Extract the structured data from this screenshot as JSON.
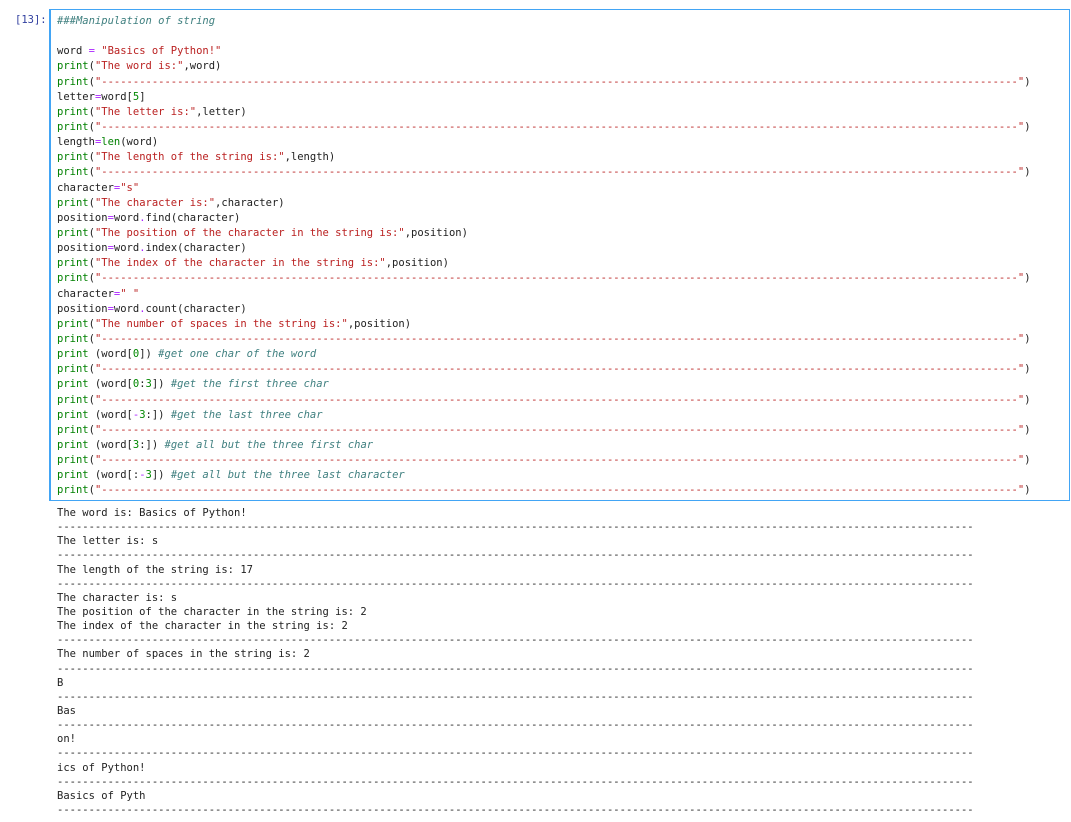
{
  "cell": {
    "prompt": "[13]:",
    "code_lines": [
      [
        {
          "t": "###Manipulation of string",
          "c": "cm"
        }
      ],
      [
        {
          "t": "",
          "c": "pl"
        }
      ],
      [
        {
          "t": "word ",
          "c": "pl"
        },
        {
          "t": "=",
          "c": "op"
        },
        {
          "t": " ",
          "c": "pl"
        },
        {
          "t": "\"Basics of Python!\"",
          "c": "st"
        }
      ],
      [
        {
          "t": "print",
          "c": "kw"
        },
        {
          "t": "(",
          "c": "pl"
        },
        {
          "t": "\"The word is:\"",
          "c": "st"
        },
        {
          "t": ",word)",
          "c": "pl"
        }
      ],
      [
        {
          "t": "print",
          "c": "kw"
        },
        {
          "t": "(",
          "c": "pl"
        },
        {
          "t": "\"-------------------------------------------------------------------------------------------------------------------------------------------------\"",
          "c": "st"
        },
        {
          "t": ")",
          "c": "pl"
        }
      ],
      [
        {
          "t": "letter",
          "c": "pl"
        },
        {
          "t": "=",
          "c": "op"
        },
        {
          "t": "word[",
          "c": "pl"
        },
        {
          "t": "5",
          "c": "nu"
        },
        {
          "t": "]",
          "c": "pl"
        }
      ],
      [
        {
          "t": "print",
          "c": "kw"
        },
        {
          "t": "(",
          "c": "pl"
        },
        {
          "t": "\"The letter is:\"",
          "c": "st"
        },
        {
          "t": ",letter)",
          "c": "pl"
        }
      ],
      [
        {
          "t": "print",
          "c": "kw"
        },
        {
          "t": "(",
          "c": "pl"
        },
        {
          "t": "\"-------------------------------------------------------------------------------------------------------------------------------------------------\"",
          "c": "st"
        },
        {
          "t": ")",
          "c": "pl"
        }
      ],
      [
        {
          "t": "length",
          "c": "pl"
        },
        {
          "t": "=",
          "c": "op"
        },
        {
          "t": "len",
          "c": "kw"
        },
        {
          "t": "(word)",
          "c": "pl"
        }
      ],
      [
        {
          "t": "print",
          "c": "kw"
        },
        {
          "t": "(",
          "c": "pl"
        },
        {
          "t": "\"The length of the string is:\"",
          "c": "st"
        },
        {
          "t": ",length)",
          "c": "pl"
        }
      ],
      [
        {
          "t": "print",
          "c": "kw"
        },
        {
          "t": "(",
          "c": "pl"
        },
        {
          "t": "\"-------------------------------------------------------------------------------------------------------------------------------------------------\"",
          "c": "st"
        },
        {
          "t": ")",
          "c": "pl"
        }
      ],
      [
        {
          "t": "character",
          "c": "pl"
        },
        {
          "t": "=",
          "c": "op"
        },
        {
          "t": "\"s\"",
          "c": "st"
        }
      ],
      [
        {
          "t": "print",
          "c": "kw"
        },
        {
          "t": "(",
          "c": "pl"
        },
        {
          "t": "\"The character is:\"",
          "c": "st"
        },
        {
          "t": ",character)",
          "c": "pl"
        }
      ],
      [
        {
          "t": "position",
          "c": "pl"
        },
        {
          "t": "=",
          "c": "op"
        },
        {
          "t": "word",
          "c": "pl"
        },
        {
          "t": ".",
          "c": "op"
        },
        {
          "t": "find(character)",
          "c": "pl"
        }
      ],
      [
        {
          "t": "print",
          "c": "kw"
        },
        {
          "t": "(",
          "c": "pl"
        },
        {
          "t": "\"The position of the character in the string is:\"",
          "c": "st"
        },
        {
          "t": ",position)",
          "c": "pl"
        }
      ],
      [
        {
          "t": "position",
          "c": "pl"
        },
        {
          "t": "=",
          "c": "op"
        },
        {
          "t": "word",
          "c": "pl"
        },
        {
          "t": ".",
          "c": "op"
        },
        {
          "t": "index(character)",
          "c": "pl"
        }
      ],
      [
        {
          "t": "print",
          "c": "kw"
        },
        {
          "t": "(",
          "c": "pl"
        },
        {
          "t": "\"The index of the character in the string is:\"",
          "c": "st"
        },
        {
          "t": ",position)",
          "c": "pl"
        }
      ],
      [
        {
          "t": "print",
          "c": "kw"
        },
        {
          "t": "(",
          "c": "pl"
        },
        {
          "t": "\"-------------------------------------------------------------------------------------------------------------------------------------------------\"",
          "c": "st"
        },
        {
          "t": ")",
          "c": "pl"
        }
      ],
      [
        {
          "t": "character",
          "c": "pl"
        },
        {
          "t": "=",
          "c": "op"
        },
        {
          "t": "\" \"",
          "c": "st"
        }
      ],
      [
        {
          "t": "position",
          "c": "pl"
        },
        {
          "t": "=",
          "c": "op"
        },
        {
          "t": "word",
          "c": "pl"
        },
        {
          "t": ".",
          "c": "op"
        },
        {
          "t": "count(character)",
          "c": "pl"
        }
      ],
      [
        {
          "t": "print",
          "c": "kw"
        },
        {
          "t": "(",
          "c": "pl"
        },
        {
          "t": "\"The number of spaces in the string is:\"",
          "c": "st"
        },
        {
          "t": ",position)",
          "c": "pl"
        }
      ],
      [
        {
          "t": "print",
          "c": "kw"
        },
        {
          "t": "(",
          "c": "pl"
        },
        {
          "t": "\"-------------------------------------------------------------------------------------------------------------------------------------------------\"",
          "c": "st"
        },
        {
          "t": ")",
          "c": "pl"
        }
      ],
      [
        {
          "t": "print",
          "c": "kw"
        },
        {
          "t": " (word[",
          "c": "pl"
        },
        {
          "t": "0",
          "c": "nu"
        },
        {
          "t": "]) ",
          "c": "pl"
        },
        {
          "t": "#get one char of the word",
          "c": "cm"
        }
      ],
      [
        {
          "t": "print",
          "c": "kw"
        },
        {
          "t": "(",
          "c": "pl"
        },
        {
          "t": "\"-------------------------------------------------------------------------------------------------------------------------------------------------\"",
          "c": "st"
        },
        {
          "t": ")",
          "c": "pl"
        }
      ],
      [
        {
          "t": "print",
          "c": "kw"
        },
        {
          "t": " (word[",
          "c": "pl"
        },
        {
          "t": "0",
          "c": "nu"
        },
        {
          "t": ":",
          "c": "pl"
        },
        {
          "t": "3",
          "c": "nu"
        },
        {
          "t": "]) ",
          "c": "pl"
        },
        {
          "t": "#get the first three char",
          "c": "cm"
        }
      ],
      [
        {
          "t": "print",
          "c": "kw"
        },
        {
          "t": "(",
          "c": "pl"
        },
        {
          "t": "\"-------------------------------------------------------------------------------------------------------------------------------------------------\"",
          "c": "st"
        },
        {
          "t": ")",
          "c": "pl"
        }
      ],
      [
        {
          "t": "print",
          "c": "kw"
        },
        {
          "t": " (word[",
          "c": "pl"
        },
        {
          "t": "-",
          "c": "op"
        },
        {
          "t": "3",
          "c": "nu"
        },
        {
          "t": ":]) ",
          "c": "pl"
        },
        {
          "t": "#get the last three char",
          "c": "cm"
        }
      ],
      [
        {
          "t": "print",
          "c": "kw"
        },
        {
          "t": "(",
          "c": "pl"
        },
        {
          "t": "\"-------------------------------------------------------------------------------------------------------------------------------------------------\"",
          "c": "st"
        },
        {
          "t": ")",
          "c": "pl"
        }
      ],
      [
        {
          "t": "print",
          "c": "kw"
        },
        {
          "t": " (word[",
          "c": "pl"
        },
        {
          "t": "3",
          "c": "nu"
        },
        {
          "t": ":]) ",
          "c": "pl"
        },
        {
          "t": "#get all but the three first char",
          "c": "cm"
        }
      ],
      [
        {
          "t": "print",
          "c": "kw"
        },
        {
          "t": "(",
          "c": "pl"
        },
        {
          "t": "\"-------------------------------------------------------------------------------------------------------------------------------------------------\"",
          "c": "st"
        },
        {
          "t": ")",
          "c": "pl"
        }
      ],
      [
        {
          "t": "print",
          "c": "kw"
        },
        {
          "t": " (word[:",
          "c": "pl"
        },
        {
          "t": "-",
          "c": "op"
        },
        {
          "t": "3",
          "c": "nu"
        },
        {
          "t": "]) ",
          "c": "pl"
        },
        {
          "t": "#get all but the three last character",
          "c": "cm"
        }
      ],
      [
        {
          "t": "print",
          "c": "kw"
        },
        {
          "t": "(",
          "c": "pl"
        },
        {
          "t": "\"-------------------------------------------------------------------------------------------------------------------------------------------------\"",
          "c": "st"
        },
        {
          "t": ")",
          "c": "pl"
        }
      ]
    ]
  },
  "output": {
    "lines": [
      "The word is: Basics of Python!",
      "-------------------------------------------------------------------------------------------------------------------------------------------------",
      "The letter is: s",
      "-------------------------------------------------------------------------------------------------------------------------------------------------",
      "The length of the string is: 17",
      "-------------------------------------------------------------------------------------------------------------------------------------------------",
      "The character is: s",
      "The position of the character in the string is: 2",
      "The index of the character in the string is: 2",
      "-------------------------------------------------------------------------------------------------------------------------------------------------",
      "The number of spaces in the string is: 2",
      "-------------------------------------------------------------------------------------------------------------------------------------------------",
      "B",
      "-------------------------------------------------------------------------------------------------------------------------------------------------",
      "Bas",
      "-------------------------------------------------------------------------------------------------------------------------------------------------",
      "on!",
      "-------------------------------------------------------------------------------------------------------------------------------------------------",
      "ics of Python!",
      "-------------------------------------------------------------------------------------------------------------------------------------------------",
      "Basics of Pyth",
      "-------------------------------------------------------------------------------------------------------------------------------------------------"
    ]
  },
  "colors": {
    "cell_border": "#42a5f5",
    "prompt": "#303f9f",
    "keyword": "#008000",
    "string": "#ba2121",
    "comment": "#408080",
    "operator": "#aa22ff"
  }
}
